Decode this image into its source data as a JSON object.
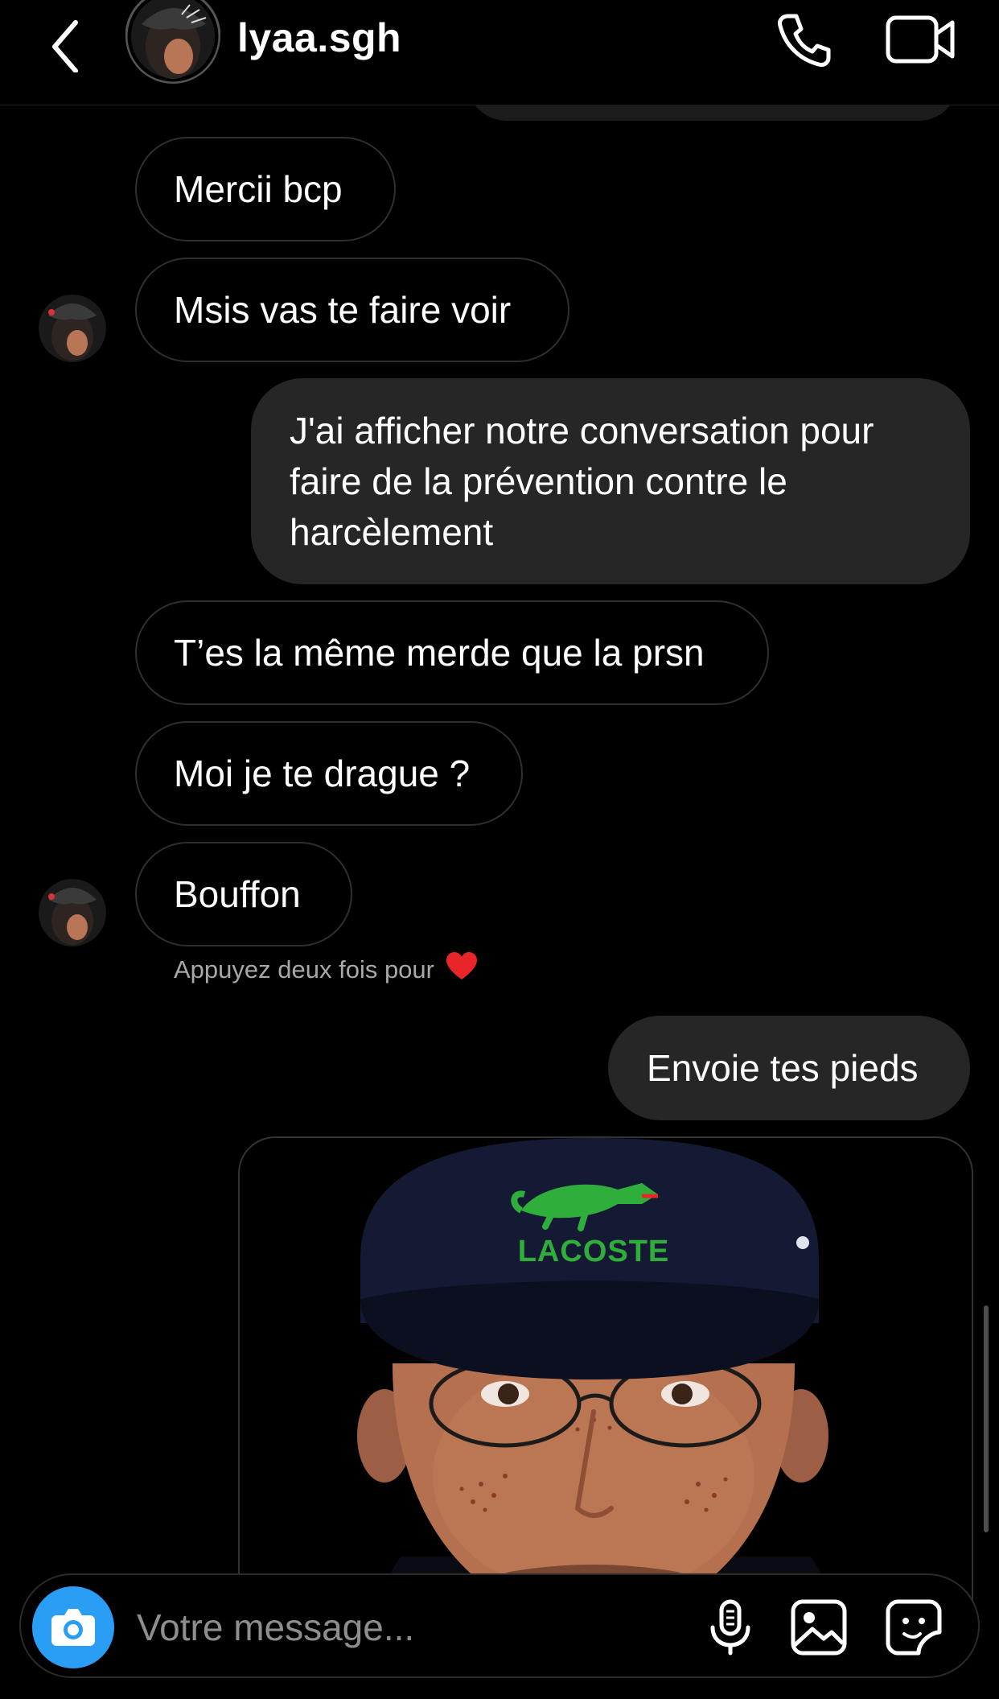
{
  "header": {
    "username": "lyaa.sgh"
  },
  "messages": [
    {
      "text": "Mercii bcp"
    },
    {
      "text": "Msis vas te faire voir"
    },
    {
      "text": "J'ai afficher notre conversation pour faire de la prévention contre le harcèlement"
    },
    {
      "text": "T’es la même merde que la prsn"
    },
    {
      "text": "Moi je te drague ?"
    },
    {
      "text": "Bouffon"
    },
    {
      "text": "Envoie tes pieds"
    }
  ],
  "reaction_hint": {
    "text": "Appuyez deux fois pour",
    "icon": "heart-icon"
  },
  "media": {
    "cap_text": "LACOSTE"
  },
  "composer": {
    "placeholder": "Votre message..."
  },
  "colors": {
    "background": "#000000",
    "outgoing_bubble": "#262626",
    "incoming_border": "#2f2f2f",
    "camera_button": "#2a9ef5",
    "hint_text": "#a8a8a8",
    "heart": "#e8262a",
    "lacoste_green": "#2fae3c"
  },
  "icons": [
    "back-arrow-icon",
    "phone-icon",
    "video-camera-icon",
    "camera-icon",
    "microphone-icon",
    "gallery-icon",
    "sticker-icon",
    "heart-icon"
  ]
}
